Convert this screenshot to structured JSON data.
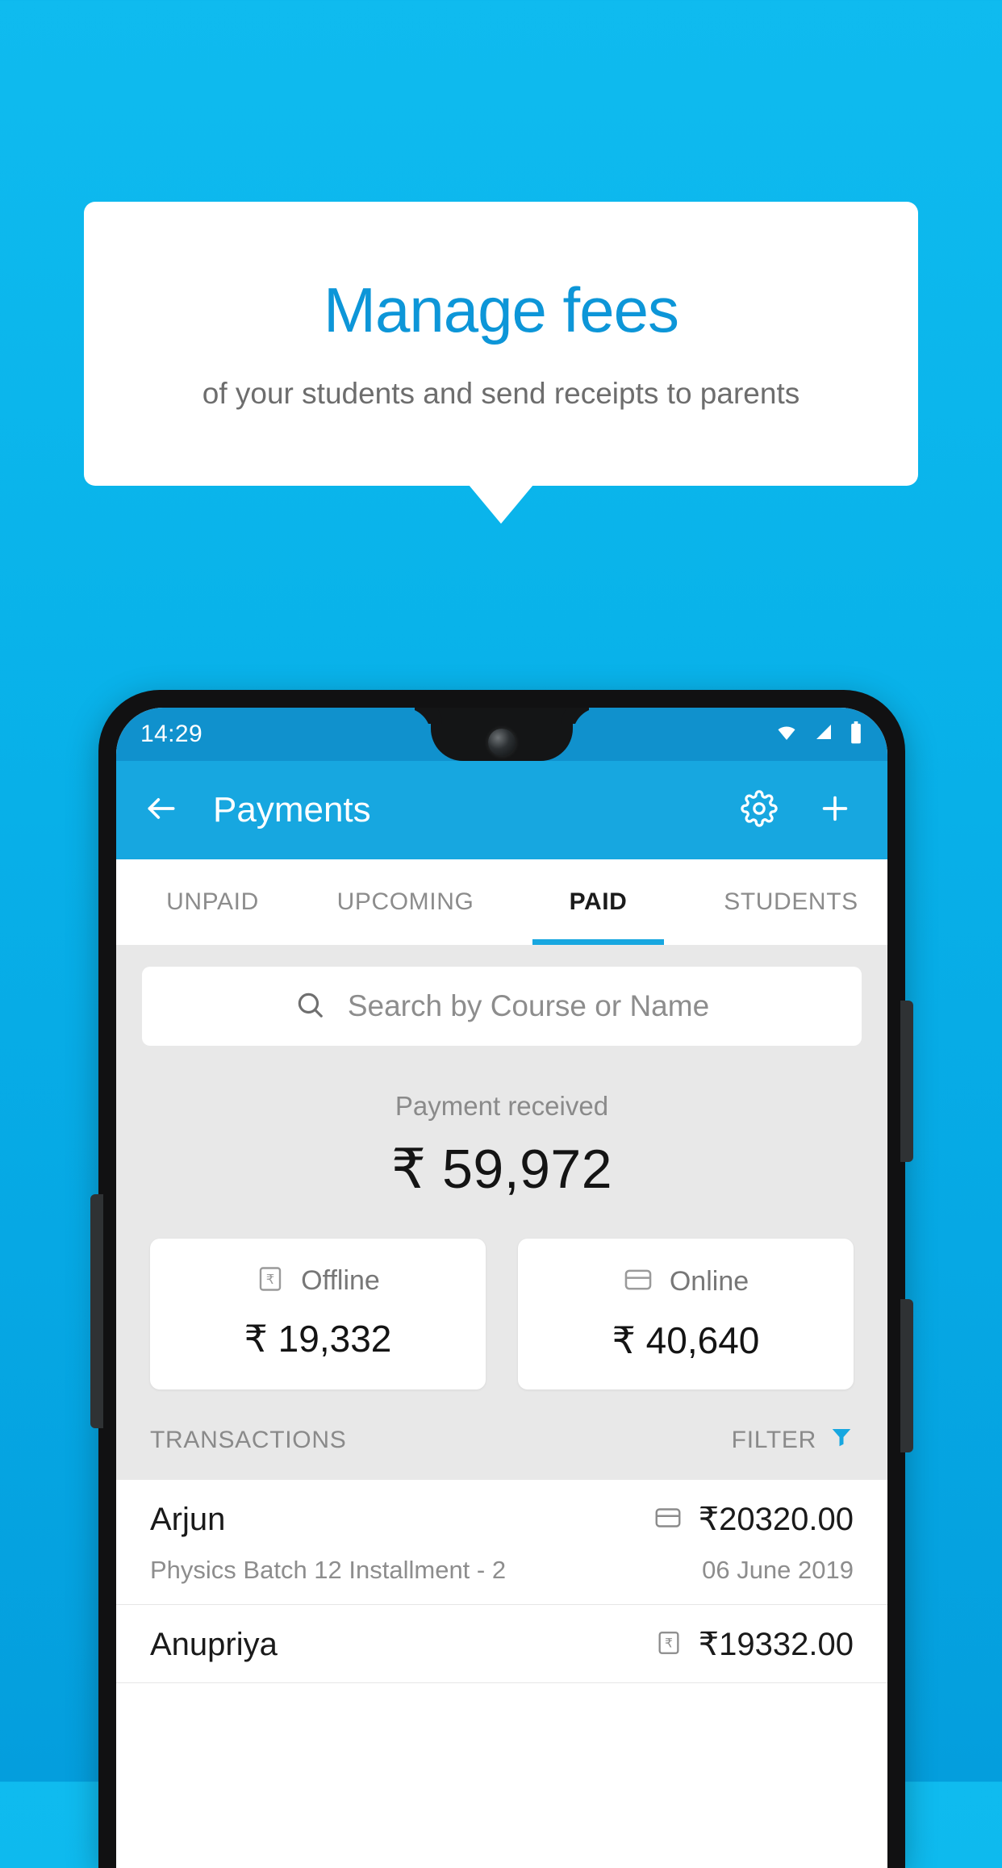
{
  "promo": {
    "title": "Manage fees",
    "subtitle": "of your students and send receipts to parents",
    "accent": "#0d96d8",
    "background": "#0fbbef"
  },
  "phone": {
    "statusbar": {
      "time": "14:29",
      "icons": [
        "wifi-icon",
        "signal-icon",
        "battery-icon"
      ]
    },
    "appbar": {
      "back_icon": "arrow-left-icon",
      "title": "Payments",
      "settings_icon": "gear-icon",
      "add_icon": "plus-icon",
      "color": "#17a7e0"
    },
    "tabs": [
      {
        "label": "UNPAID",
        "active": false
      },
      {
        "label": "UPCOMING",
        "active": false
      },
      {
        "label": "PAID",
        "active": true
      },
      {
        "label": "STUDENTS",
        "active": false
      }
    ],
    "search": {
      "icon": "search-icon",
      "placeholder": "Search by Course or Name",
      "value": ""
    },
    "summary": {
      "label": "Payment received",
      "amount": "₹ 59,972"
    },
    "methods": [
      {
        "icon": "rupee-note-icon",
        "label": "Offline",
        "amount": "₹ 19,332"
      },
      {
        "icon": "credit-card-icon",
        "label": "Online",
        "amount": "₹ 40,640"
      }
    ],
    "list_header": {
      "title": "TRANSACTIONS",
      "filter_label": "FILTER",
      "filter_icon": "funnel-icon",
      "filter_color": "#17a7e0"
    },
    "transactions": [
      {
        "name": "Arjun",
        "description": "Physics Batch 12 Installment - 2",
        "amount": "₹20320.00",
        "date": "06 June 2019",
        "method_icon": "credit-card-icon"
      },
      {
        "name": "Anupriya",
        "description": "",
        "amount": "₹19332.00",
        "date": "",
        "method_icon": "rupee-note-icon"
      }
    ]
  }
}
